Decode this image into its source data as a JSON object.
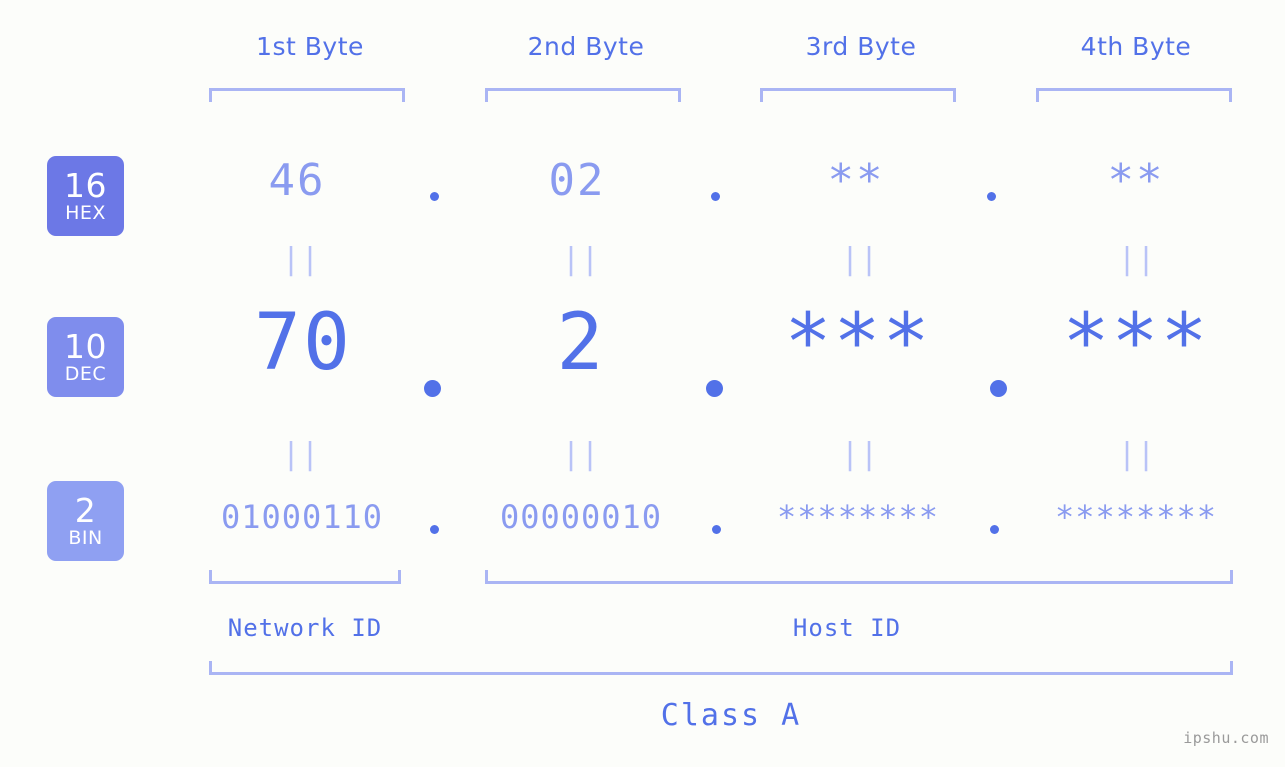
{
  "watermark": "ipshu.com",
  "byte_headers": [
    {
      "label": "1st Byte"
    },
    {
      "label": "2nd Byte"
    },
    {
      "label": "3rd Byte"
    },
    {
      "label": "4th Byte"
    }
  ],
  "bases": [
    {
      "num": "16",
      "name": "HEX",
      "color": "#6c78e6"
    },
    {
      "num": "10",
      "name": "DEC",
      "color": "#7f8ded"
    },
    {
      "num": "2",
      "name": "BIN",
      "color": "#8fa0f2"
    }
  ],
  "rows": {
    "hex": {
      "bytes": [
        "46",
        "02",
        "**",
        "**"
      ]
    },
    "dec": {
      "bytes": [
        "70",
        "2",
        "***",
        "***"
      ]
    },
    "bin": {
      "bytes": [
        "01000110",
        "00000010",
        "********",
        "********"
      ]
    }
  },
  "separators": {
    "dot": ".",
    "equals": "||"
  },
  "sections": {
    "network_id": "Network ID",
    "host_id": "Host ID",
    "class": "Class A"
  },
  "colors": {
    "background": "#fcfdfa",
    "accent_strong": "#5271e8",
    "accent_light": "#8a9bf0",
    "bracket": "#aab5f4",
    "equals": "#b9c3f7"
  }
}
